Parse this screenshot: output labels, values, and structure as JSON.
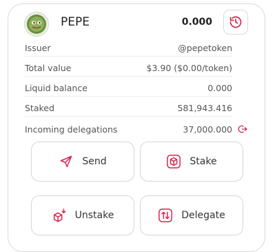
{
  "token": {
    "symbol": "PEPE",
    "balance": "0.000",
    "icon": "pepe-token-logo"
  },
  "details": [
    {
      "label": "Issuer",
      "value": "@pepetoken"
    },
    {
      "label": "Total value",
      "value": "$3.90 ($0.00/token)"
    },
    {
      "label": "Liquid balance",
      "value": "0.000"
    },
    {
      "label": "Staked",
      "value": "581,943.416"
    },
    {
      "label": "Incoming delegations",
      "value": "37,000.000"
    }
  ],
  "actions": {
    "send": "Send",
    "stake": "Stake",
    "unstake": "Unstake",
    "delegate": "Delegate"
  },
  "colors": {
    "accent": "#d6244a",
    "border": "#d9d9d9",
    "text": "#333333"
  }
}
